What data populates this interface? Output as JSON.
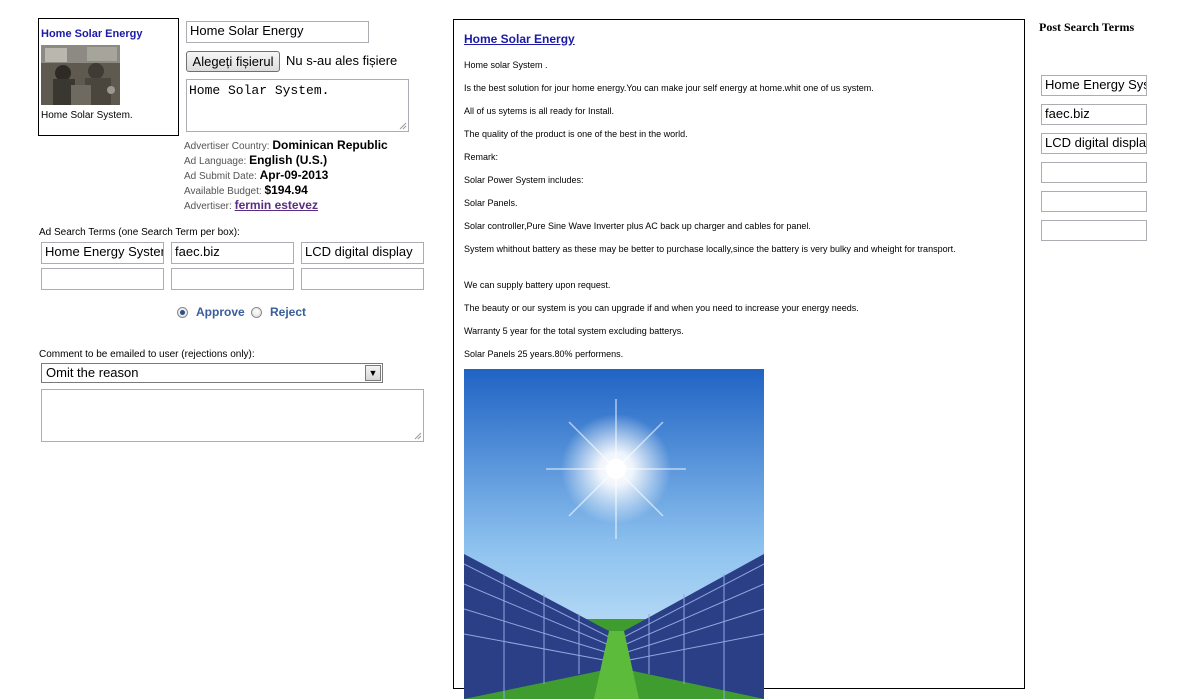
{
  "ad": {
    "preview_title": "Home Solar Energy",
    "preview_desc": "Home Solar System.",
    "title_value": "Home Solar Energy",
    "file_button": "Alegeți fișierul",
    "file_status": "Nu s-au ales fișiere",
    "description_value": "Home Solar System."
  },
  "meta": {
    "country_label": "Advertiser Country:",
    "country_value": "Dominican Republic",
    "language_label": "Ad Language:",
    "language_value": "English (U.S.)",
    "date_label": "Ad Submit Date:",
    "date_value": "Apr-09-2013",
    "budget_label": "Available Budget:",
    "budget_value": "$194.94",
    "advertiser_label": "Advertiser:",
    "advertiser_value": "fermin estevez"
  },
  "search_terms": {
    "label": "Ad Search Terms (one Search Term per box):",
    "terms": [
      "Home Energy System",
      "faec.biz",
      "LCD digital display",
      "",
      "",
      ""
    ]
  },
  "review": {
    "approve_label": "Approve",
    "reject_label": "Reject",
    "selected": "approve"
  },
  "comment": {
    "label": "Comment to be emailed to user (rejections only):",
    "selected_reason": "Omit the reason",
    "text": ""
  },
  "landing": {
    "title": "Home Solar Energy",
    "lines": [
      "Home solar System .",
      "Is the best solution for jour home energy.You can make jour self energy at home.whit one of us system.",
      "All of us sytems is  all ready for Install.",
      "The quality  of the product is one of the best in the world.",
      "Remark:",
      "Solar Power System includes:",
      "Solar Panels.",
      "Solar controller,Pure Sine Wave Inverter plus AC back up charger and cables for panel.",
      "System whithout battery as these may be better to purchase locally,since the battery is very bulky and wheight for transport.",
      "We can supply battery upon request.",
      "The beauty or our system is you can upgrade if and  when you need to increase your energy needs.",
      "Warranty 5 year for the total system excluding batterys.",
      "Solar Panels 25 years.80% performens."
    ]
  },
  "post_search": {
    "heading": "Post Search Terms",
    "terms": [
      "Home Energy System",
      "faec.biz",
      "LCD digital display",
      "",
      "",
      ""
    ]
  },
  "colors": {
    "link": "#1a1aa6",
    "visited_link": "#5a2d82",
    "radio_label": "#3a5d9c"
  }
}
